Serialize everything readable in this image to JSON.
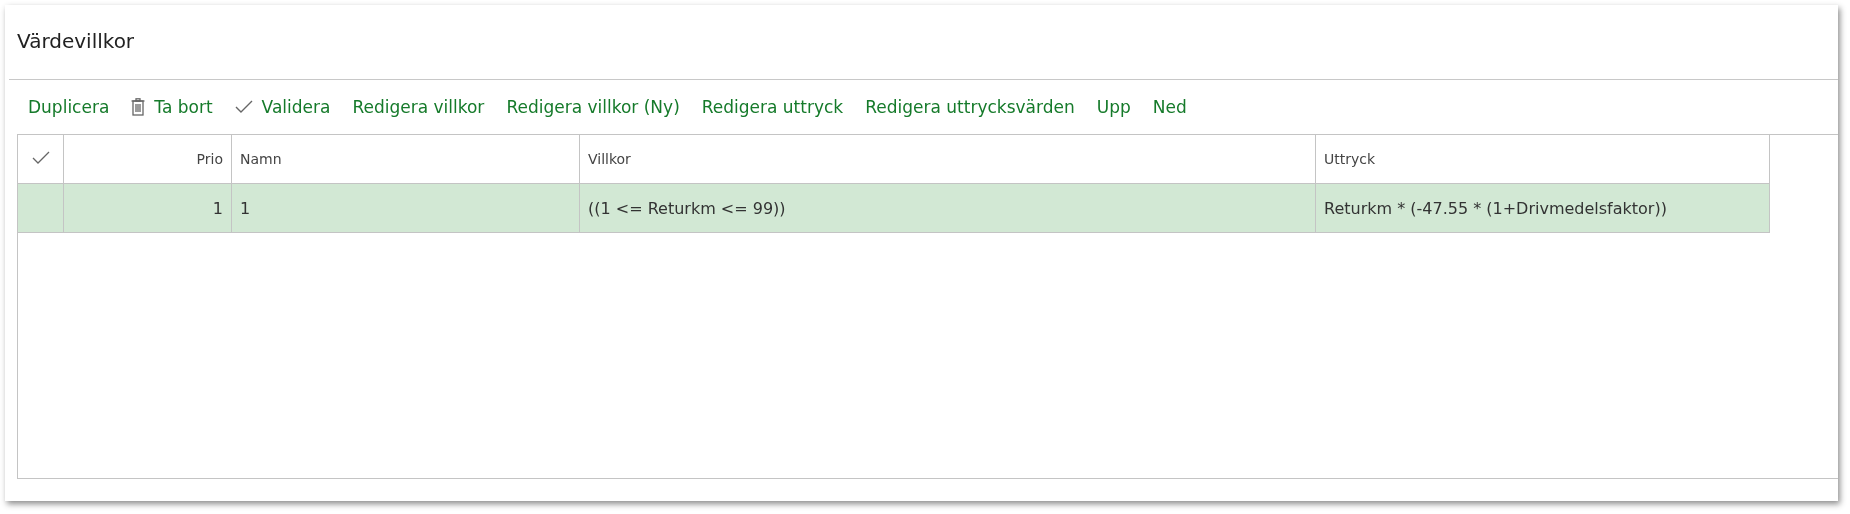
{
  "title": "Värdevillkor",
  "toolbar": [
    {
      "label": "Duplicera",
      "kind": "plain"
    },
    {
      "label": "Ta bort",
      "kind": "trash"
    },
    {
      "label": "Validera",
      "kind": "check"
    },
    {
      "label": "Redigera villkor",
      "kind": "plain"
    },
    {
      "label": "Redigera villkor (Ny)",
      "kind": "plain"
    },
    {
      "label": "Redigera uttryck",
      "kind": "plain"
    },
    {
      "label": "Redigera uttrycksvärden",
      "kind": "plain"
    },
    {
      "label": "Upp",
      "kind": "plain"
    },
    {
      "label": "Ned",
      "kind": "plain"
    }
  ],
  "table": {
    "columns": [
      "Prio",
      "Namn",
      "Villkor",
      "Uttryck"
    ],
    "rows": [
      {
        "selected": true,
        "cells": [
          "1",
          "1",
          "((1 <= Returkm <= 99))",
          "Returkm * (-47.55 * (1+Drivmedelsfaktor))"
        ]
      }
    ]
  }
}
